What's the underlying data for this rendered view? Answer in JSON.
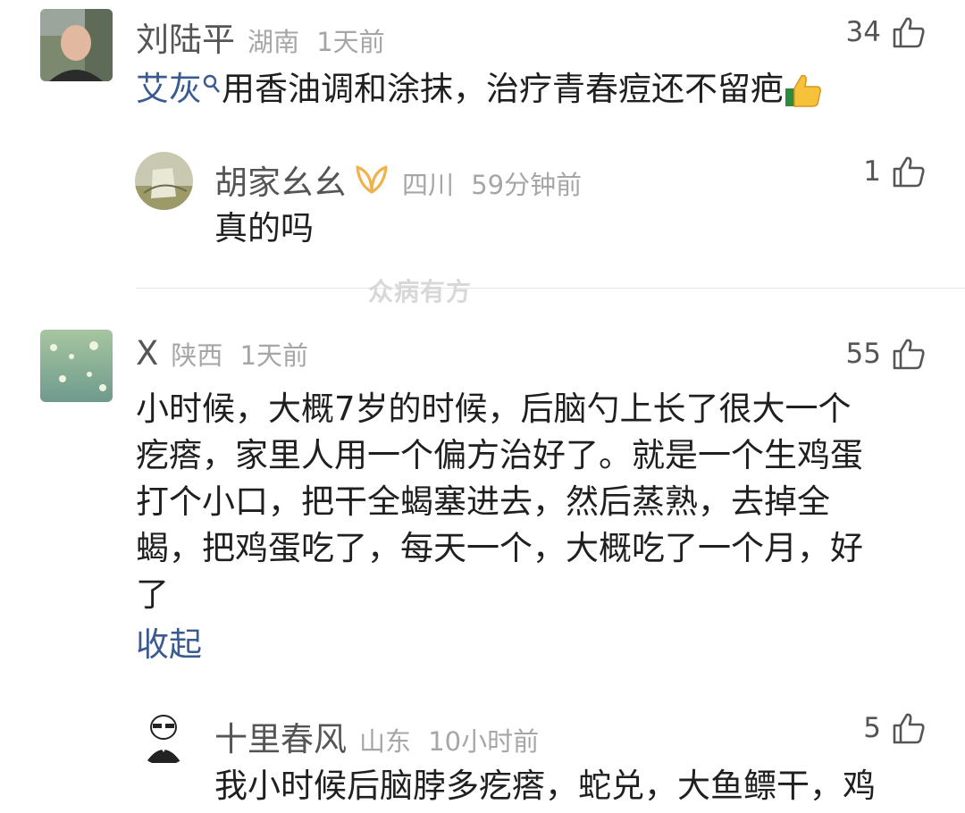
{
  "comments": [
    {
      "username": "刘陆平",
      "location": "湖南",
      "time": "1天前",
      "likes": "34",
      "mention": "艾灰",
      "text": "用香油调和涂抹，治疗青春痘还不留疤",
      "reply": {
        "username": "胡家幺幺",
        "location": "四川",
        "time": "59分钟前",
        "likes": "1",
        "text": "真的吗"
      }
    },
    {
      "username": "X",
      "location": "陕西",
      "time": "1天前",
      "likes": "55",
      "lines": [
        "小时候，大概7岁的时候，后脑勺上长了很大一个",
        "疙瘩，家里人用一个偏方治好了。就是一个生鸡蛋",
        "打个小口，把干全蝎塞进去，然后蒸熟，去掉全",
        "蝎，把鸡蛋吃了，每天一个，大概吃了一个月，好",
        "了"
      ],
      "collapse_label": "收起",
      "reply": {
        "username": "十里春风",
        "location": "山东",
        "time": "10小时前",
        "likes": "5",
        "text": "我小时候后脑脖多疙瘩，蛇兑，大鱼鳔干，鸡"
      }
    }
  ],
  "watermark": "众病有方",
  "colors": {
    "link": "#3a5a90",
    "meta": "#a6a6a6",
    "vip_badge": "#f0b24a"
  },
  "icons": [
    "thumbs-up-icon",
    "search-icon",
    "vip-badge-icon",
    "thumbs-up-emoji-icon"
  ]
}
